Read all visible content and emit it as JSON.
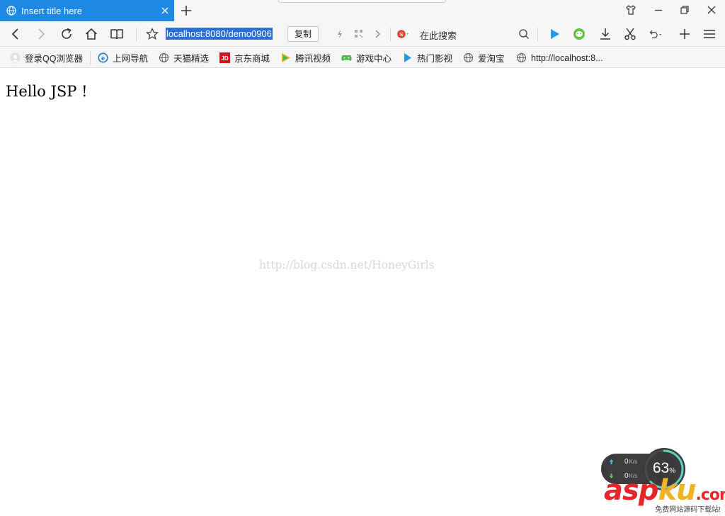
{
  "tab": {
    "title": "Insert title here"
  },
  "address_bar": {
    "url": "localhost:8080/demo0906",
    "copy_label": "复制",
    "search_label": "在此搜索"
  },
  "bookmarks": [
    {
      "label": "登录QQ浏览器",
      "icon": "user-avatar-icon"
    },
    {
      "label": "上网导航",
      "icon": "ie-e-icon"
    },
    {
      "label": "天猫精选",
      "icon": "globe-icon"
    },
    {
      "label": "京东商城",
      "icon": "jd-logo-icon"
    },
    {
      "label": "腾讯视频",
      "icon": "tencent-video-icon"
    },
    {
      "label": "游戏中心",
      "icon": "gamepad-icon"
    },
    {
      "label": "热门影视",
      "icon": "play-icon"
    },
    {
      "label": "爱淘宝",
      "icon": "globe-icon"
    },
    {
      "label": "http://localhost:8...",
      "icon": "globe-icon"
    }
  ],
  "page": {
    "heading": "Hello JSP !",
    "watermark": "http://blog.csdn.net/HoneyGirls"
  },
  "speed_widget": {
    "upload": "0",
    "download": "0",
    "unit": "K/s",
    "gauge": "63",
    "gauge_unit": "%"
  },
  "site_logo": {
    "part1": "asp",
    "part2": "ku",
    "part3": ".com",
    "subtitle": "免费网站源码下载站!"
  },
  "colors": {
    "accent": "#1e88e5",
    "selection": "#2a6fd6",
    "gauge_ring": "#5fd3c2"
  }
}
